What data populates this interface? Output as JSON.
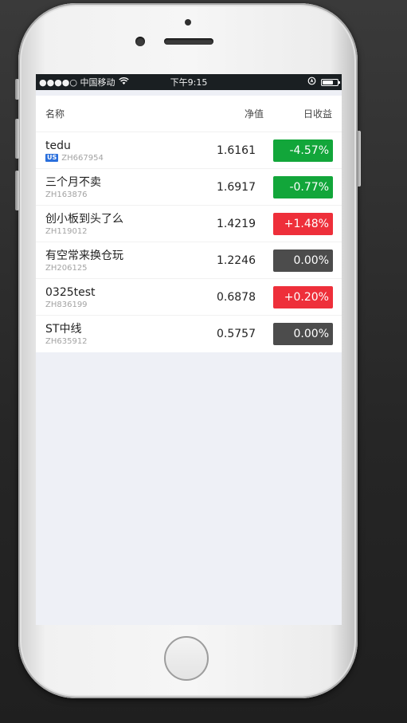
{
  "status_bar": {
    "carrier": "●●●●○ 中国移动",
    "time": "下午9:15",
    "battery_level": 0.7
  },
  "table": {
    "headers": {
      "name": "名称",
      "nav": "净值",
      "daily_return": "日收益"
    },
    "rows": [
      {
        "name": "tedu",
        "market_badge": "US",
        "code": "ZH667954",
        "nav": "1.6161",
        "daily_return": "-4.57%",
        "trend": "down"
      },
      {
        "name": "三个月不卖",
        "market_badge": "",
        "code": "ZH163876",
        "nav": "1.6917",
        "daily_return": "-0.77%",
        "trend": "down"
      },
      {
        "name": "创小板到头了么",
        "market_badge": "",
        "code": "ZH119012",
        "nav": "1.4219",
        "daily_return": "+1.48%",
        "trend": "up"
      },
      {
        "name": "有空常来换仓玩",
        "market_badge": "",
        "code": "ZH206125",
        "nav": "1.2246",
        "daily_return": "0.00%",
        "trend": "flat"
      },
      {
        "name": "0325test",
        "market_badge": "",
        "code": "ZH836199",
        "nav": "0.6878",
        "daily_return": "+0.20%",
        "trend": "up"
      },
      {
        "name": "ST中线",
        "market_badge": "",
        "code": "ZH635912",
        "nav": "0.5757",
        "daily_return": "0.00%",
        "trend": "flat"
      }
    ]
  },
  "colors": {
    "down": "#12a63a",
    "up": "#ee2f3a",
    "flat": "#4c4c4c",
    "screen_bg": "#eef0f6",
    "status_bar_bg": "#1a1f22"
  },
  "icons": {
    "wifi": "wifi-icon",
    "location": "location-icon",
    "battery": "battery-icon"
  }
}
